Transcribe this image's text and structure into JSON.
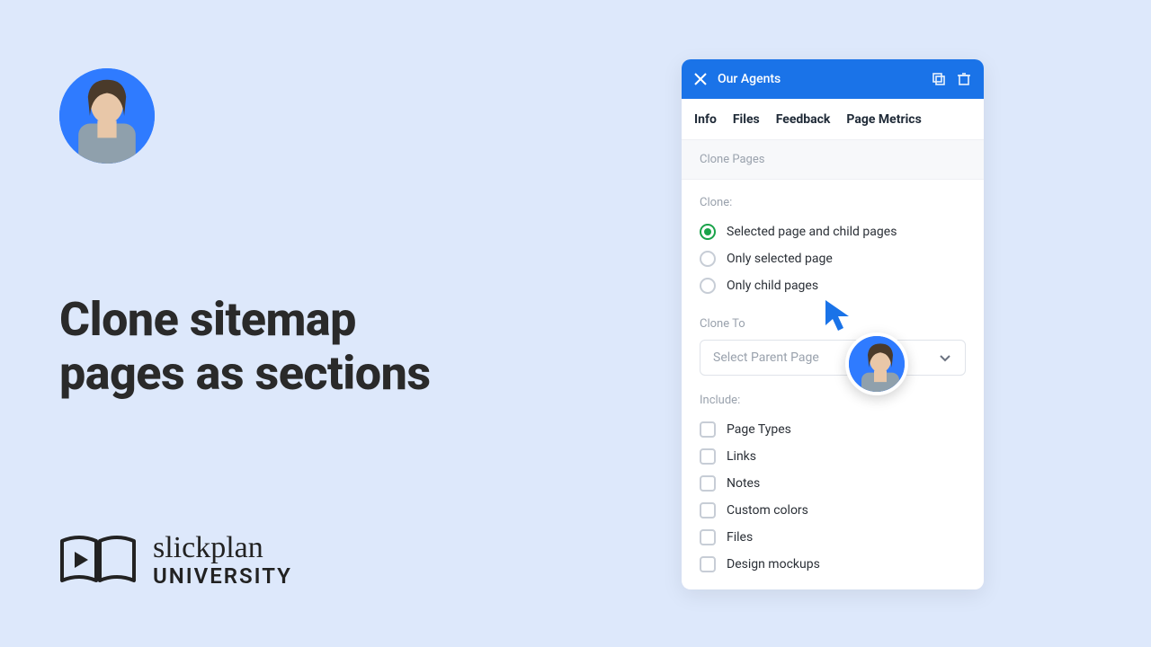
{
  "heading": {
    "line1": "Clone sitemap",
    "line2": "pages as sections"
  },
  "brand": {
    "script": "slickplan",
    "caps": "UNIVERSITY"
  },
  "panel": {
    "title": "Our Agents",
    "tabs": [
      "Info",
      "Files",
      "Feedback",
      "Page Metrics"
    ],
    "section_header": "Clone Pages",
    "clone_label": "Clone:",
    "clone_options": [
      {
        "label": "Selected page and child pages",
        "checked": true
      },
      {
        "label": "Only selected page",
        "checked": false
      },
      {
        "label": "Only child pages",
        "checked": false
      }
    ],
    "clone_to_label": "Clone To",
    "select_placeholder": "Select Parent Page",
    "include_label": "Include:",
    "include_options": [
      {
        "label": "Page Types"
      },
      {
        "label": "Links"
      },
      {
        "label": "Notes"
      },
      {
        "label": "Custom colors"
      },
      {
        "label": "Files"
      },
      {
        "label": "Design mockups"
      }
    ]
  }
}
